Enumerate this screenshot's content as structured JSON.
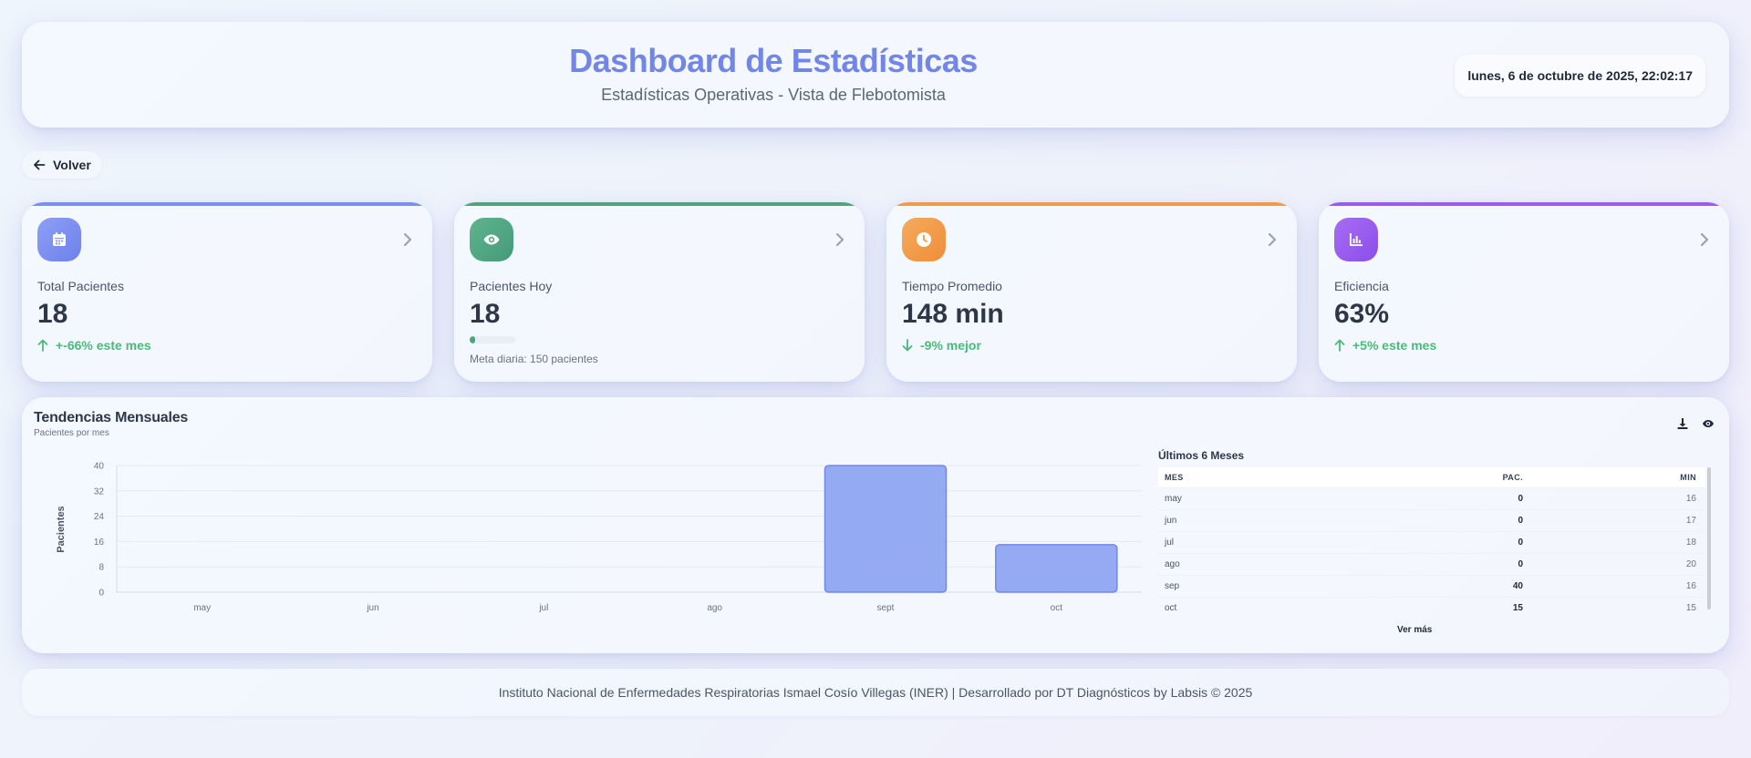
{
  "header": {
    "title": "Dashboard de Estadísticas",
    "subtitle": "Estadísticas Operativas - Vista de Flebotomista",
    "datetime": "lunes, 6 de octubre de 2025, 22:02:17"
  },
  "nav": {
    "back_label": "Volver"
  },
  "stats": [
    {
      "label": "Total Pacientes",
      "value": "18",
      "trend": "+-66% este mes",
      "trend_dir": "up",
      "accent": "#7b8ff0",
      "icon": "calendar-icon"
    },
    {
      "label": "Pacientes Hoy",
      "value": "18",
      "progress": 0.12,
      "meta": "Meta diaria: 150 pacientes",
      "accent": "#4ea57d",
      "icon": "eye-icon"
    },
    {
      "label": "Tiempo Promedio",
      "value": "148 min",
      "trend": "-9% mejor",
      "trend_dir": "down",
      "accent": "#f39a47",
      "icon": "clock-icon"
    },
    {
      "label": "Eficiencia",
      "value": "63%",
      "trend": "+5% este mes",
      "trend_dir": "up",
      "accent": "#9a5cf0",
      "icon": "bar-chart-icon"
    }
  ],
  "trends": {
    "title": "Tendencias Mensuales",
    "subtitle": "Pacientes por mes",
    "table_title": "Últimos 6 Meses",
    "columns": [
      "Mes",
      "Pac.",
      "Min"
    ],
    "rows": [
      [
        "may",
        "0",
        "16"
      ],
      [
        "jun",
        "0",
        "17"
      ],
      [
        "jul",
        "0",
        "18"
      ],
      [
        "ago",
        "0",
        "20"
      ],
      [
        "sep",
        "40",
        "16"
      ],
      [
        "oct",
        "15",
        "15"
      ]
    ],
    "more_label": "Ver más"
  },
  "chart_data": {
    "type": "bar",
    "categories": [
      "may",
      "jun",
      "jul",
      "ago",
      "sept",
      "oct"
    ],
    "values": [
      0,
      0,
      0,
      0,
      40,
      15
    ],
    "ylabel": "Pacientes",
    "xlabel": "",
    "ylim": [
      0,
      40
    ],
    "yticks": [
      0,
      8,
      16,
      24,
      32,
      40
    ],
    "color": "#8ca3f2",
    "grid": true
  },
  "footer": {
    "text": "Instituto Nacional de Enfermedades Respiratorias Ismael Cosío Villegas (INER) | Desarrollado por DT Diagnósticos by Labsis © 2025"
  }
}
